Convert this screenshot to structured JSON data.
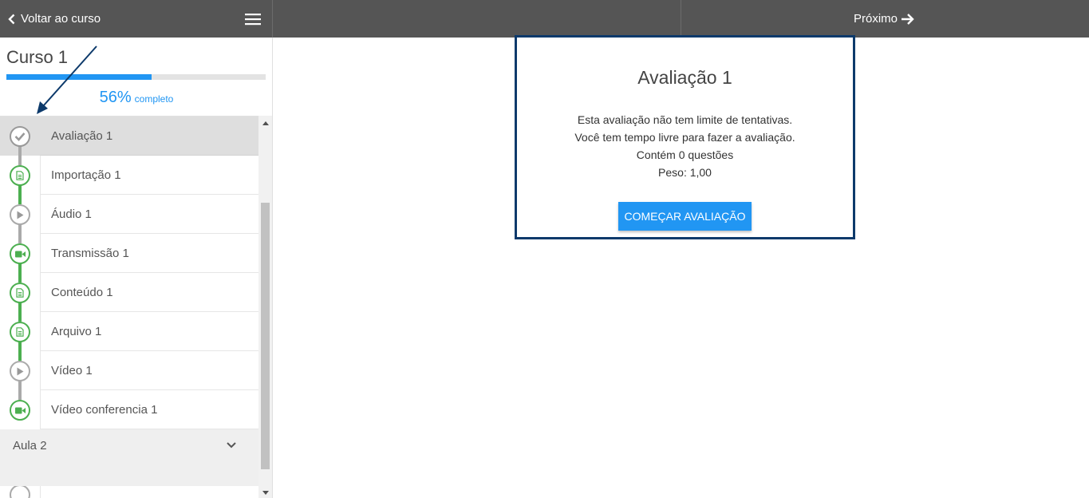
{
  "topbar": {
    "back_label": "Voltar ao curso",
    "next_label": "Próximo"
  },
  "sidebar": {
    "course_title": "Curso 1",
    "progress": {
      "percent": 56,
      "percent_label": "56%",
      "complete_label": "completo"
    },
    "items": [
      {
        "label": "Avaliação 1",
        "icon": "check-icon",
        "status": "current"
      },
      {
        "label": "Importação 1",
        "icon": "document-icon",
        "status": "completed"
      },
      {
        "label": "Áudio 1",
        "icon": "play-icon",
        "status": "pending"
      },
      {
        "label": "Transmissão 1",
        "icon": "video-camera-icon",
        "status": "completed"
      },
      {
        "label": "Conteúdo 1",
        "icon": "document-icon",
        "status": "completed"
      },
      {
        "label": "Arquivo 1",
        "icon": "document-icon",
        "status": "completed"
      },
      {
        "label": "Vídeo 1",
        "icon": "play-icon",
        "status": "pending"
      },
      {
        "label": "Vídeo conferencia 1",
        "icon": "video-camera-icon",
        "status": "completed"
      }
    ],
    "section": {
      "label": "Aula 2",
      "icon": "chevron-down-icon"
    }
  },
  "assessment": {
    "title": "Avaliação 1",
    "lines": [
      "Esta avaliação não tem limite de tentativas.",
      "Você tem tempo livre para fazer a avaliação.",
      "Contém 0 questões",
      "Peso: 1,00"
    ],
    "start_button": "COMEÇAR AVALIAÇÃO"
  },
  "colors": {
    "topbar": "#555555",
    "accent": "#2196f3",
    "completed": "#4caf50",
    "pending": "#aaaaaa",
    "card_border": "#0d3a6b"
  }
}
